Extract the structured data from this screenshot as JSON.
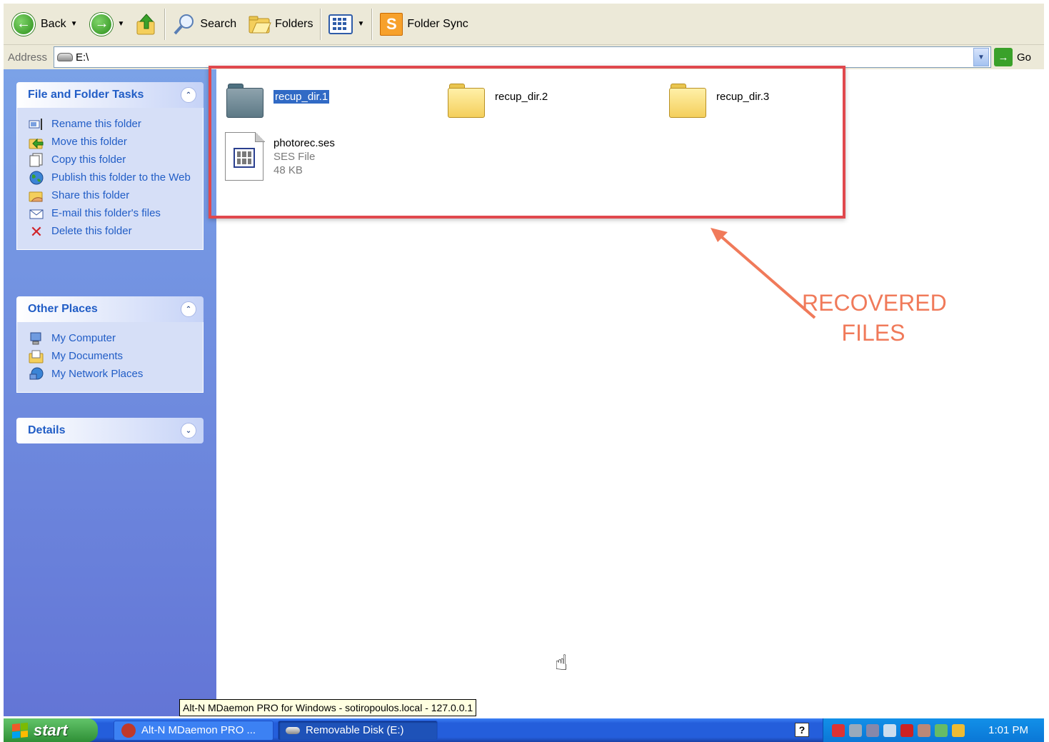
{
  "toolbar": {
    "back_label": "Back",
    "search_label": "Search",
    "folders_label": "Folders",
    "folder_sync_label": "Folder Sync"
  },
  "address": {
    "label": "Address",
    "value": "E:\\",
    "go_label": "Go"
  },
  "sidebar": {
    "file_tasks": {
      "title": "File and Folder Tasks",
      "items": [
        {
          "label": "Rename this folder",
          "icon": "rename-icon"
        },
        {
          "label": "Move this folder",
          "icon": "move-icon"
        },
        {
          "label": "Copy this folder",
          "icon": "copy-icon"
        },
        {
          "label": "Publish this folder to the Web",
          "icon": "globe-icon"
        },
        {
          "label": "Share this folder",
          "icon": "share-icon"
        },
        {
          "label": "E-mail this folder's files",
          "icon": "email-icon"
        },
        {
          "label": "Delete this folder",
          "icon": "delete-icon"
        }
      ]
    },
    "other_places": {
      "title": "Other Places",
      "items": [
        {
          "label": "My Computer",
          "icon": "computer-icon"
        },
        {
          "label": "My Documents",
          "icon": "documents-icon"
        },
        {
          "label": "My Network Places",
          "icon": "network-icon"
        }
      ]
    },
    "details": {
      "title": "Details"
    }
  },
  "files": [
    {
      "name": "recup_dir.1",
      "type": "folder",
      "selected": true
    },
    {
      "name": "recup_dir.2",
      "type": "folder",
      "selected": false
    },
    {
      "name": "recup_dir.3",
      "type": "folder",
      "selected": false
    },
    {
      "name": "photorec.ses",
      "type": "SES File",
      "size": "48 KB"
    }
  ],
  "annotation": {
    "line1": "RECOVERED",
    "line2": "FILES",
    "color": "#f07a5a",
    "box_color": "#e0484d"
  },
  "tooltip": "Alt-N MDaemon PRO for Windows - sotiropoulos.local - 127.0.0.1",
  "taskbar": {
    "start_label": "start",
    "tasks": [
      {
        "label": "Alt-N MDaemon PRO ..."
      },
      {
        "label": "Removable Disk (E:)"
      }
    ],
    "clock": "1:01 PM"
  }
}
